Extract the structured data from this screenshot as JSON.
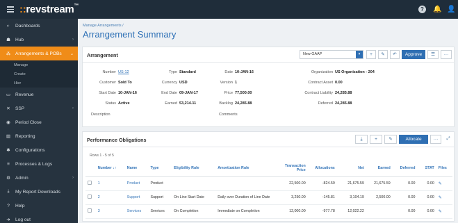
{
  "app": {
    "logo_prefix": "::",
    "logo_text": "revstream",
    "logo_tm": "™"
  },
  "topbar": {
    "help_glyph": "?",
    "bell_glyph": "🔔",
    "user_glyph": "👤"
  },
  "sidebar": {
    "items": [
      {
        "label": "Dashboards",
        "icon": "dashboard-icon",
        "glyph": "◐",
        "chevron": ""
      },
      {
        "label": "Hub",
        "icon": "hub-icon",
        "glyph": "☗",
        "chevron": "›"
      },
      {
        "label": "Arrangements & POBs",
        "icon": "arrangements-icon",
        "glyph": "⁂",
        "chevron": "⌄",
        "active": true
      },
      {
        "label": "Revenue",
        "icon": "revenue-icon",
        "glyph": "▭",
        "chevron": ""
      },
      {
        "label": "SSP",
        "icon": "ssp-icon",
        "glyph": "✕",
        "chevron": "›"
      },
      {
        "label": "Period Close",
        "icon": "period-close-icon",
        "glyph": "◉",
        "chevron": ""
      },
      {
        "label": "Reporting",
        "icon": "reporting-icon",
        "glyph": "▥",
        "chevron": ""
      },
      {
        "label": "Configurations",
        "icon": "configurations-icon",
        "glyph": "✱",
        "chevron": ""
      },
      {
        "label": "Processes & Logs",
        "icon": "processes-icon",
        "glyph": "≡",
        "chevron": ""
      },
      {
        "label": "Admin",
        "icon": "admin-icon",
        "glyph": "⚙",
        "chevron": "›"
      },
      {
        "label": "My Report Downloads",
        "icon": "downloads-icon",
        "glyph": "⤓",
        "chevron": ""
      },
      {
        "label": "Help",
        "icon": "help-icon",
        "glyph": "?",
        "chevron": ""
      },
      {
        "label": "Log out",
        "icon": "logout-icon",
        "glyph": "➜",
        "chevron": ""
      }
    ],
    "sub_items": [
      "Manage",
      "Create",
      "Hier"
    ]
  },
  "main": {
    "breadcrumb": "Manage Arrangements  /",
    "title": "Arrangement Summary"
  },
  "arrangement": {
    "title": "Arrangement",
    "view_select": "New GAAP",
    "buttons": {
      "add": "+",
      "edit": "✎",
      "undo": "↶",
      "approve": "Approve",
      "list": "☰",
      "more": "···"
    },
    "fields": {
      "number_label": "Number",
      "number": "US-12",
      "type_label": "Type",
      "type": "Standard",
      "date_label": "Date",
      "date": "10-JAN-16",
      "org_label": "Organization",
      "org": "US Organization - 204",
      "customer_label": "Customer",
      "customer": "Sold To",
      "currency_label": "Currency",
      "currency": "USD",
      "version_label": "Version",
      "version": "1",
      "contract_asset_label": "Contract Asset",
      "contract_asset": "0.00",
      "start_label": "Start Date",
      "start": "10-JAN-16",
      "end_label": "End Date",
      "end": "09-JAN-17",
      "price_label": "Price",
      "price": "77,500.00",
      "liability_label": "Contract Liability",
      "liability": "24,285.88",
      "status_label": "Status",
      "status": "Active",
      "earned_label": "Earned",
      "earned": "53,214.11",
      "backlog_label": "Backlog",
      "backlog": "24,285.88",
      "deferred_label": "Deferred",
      "deferred": "24,285.88",
      "description_label": "Description",
      "comments_label": "Comments"
    }
  },
  "pobs": {
    "title": "Performance Obligations",
    "count": "Rows 1 - 5 of 5",
    "buttons": {
      "download": "⤓",
      "add": "+",
      "edit": "✎",
      "allocate": "Allocate",
      "more": "···",
      "expand": "⤢"
    },
    "columns": [
      "",
      "Number ↓↑",
      "Name",
      "Type",
      "Eligibility Rule",
      "Amortization Rule",
      "Transaction Price",
      "Allocations",
      "Net",
      "Earned",
      "Deferred",
      "STAT",
      "Files"
    ],
    "rows": [
      {
        "number": "1",
        "name": "Product",
        "type": "Product",
        "elig": "",
        "amort": "",
        "price": "22,500.00",
        "alloc": "-824.59",
        "net": "21,675.59",
        "earned": "21,675.59",
        "deferred": "0.00",
        "stat": "0.00",
        "file": "✎"
      },
      {
        "number": "2",
        "name": "Support",
        "type": "Support",
        "elig": "On Line Start Date",
        "amort": "Daily over Duration of Line Date",
        "price": "3,250.00",
        "alloc": "-145.81",
        "net": "3,104.19",
        "earned": "2,500.00",
        "deferred": "0.00",
        "stat": "0.00",
        "file": "✎"
      },
      {
        "number": "3",
        "name": "Services",
        "type": "Services",
        "elig": "On Completion",
        "amort": "Immediate on Completion",
        "price": "12,000.00",
        "alloc": "-977.78",
        "net": "12,022.22",
        "earned": "",
        "deferred": "0.00",
        "stat": "0.00",
        "file": "✎"
      }
    ]
  }
}
